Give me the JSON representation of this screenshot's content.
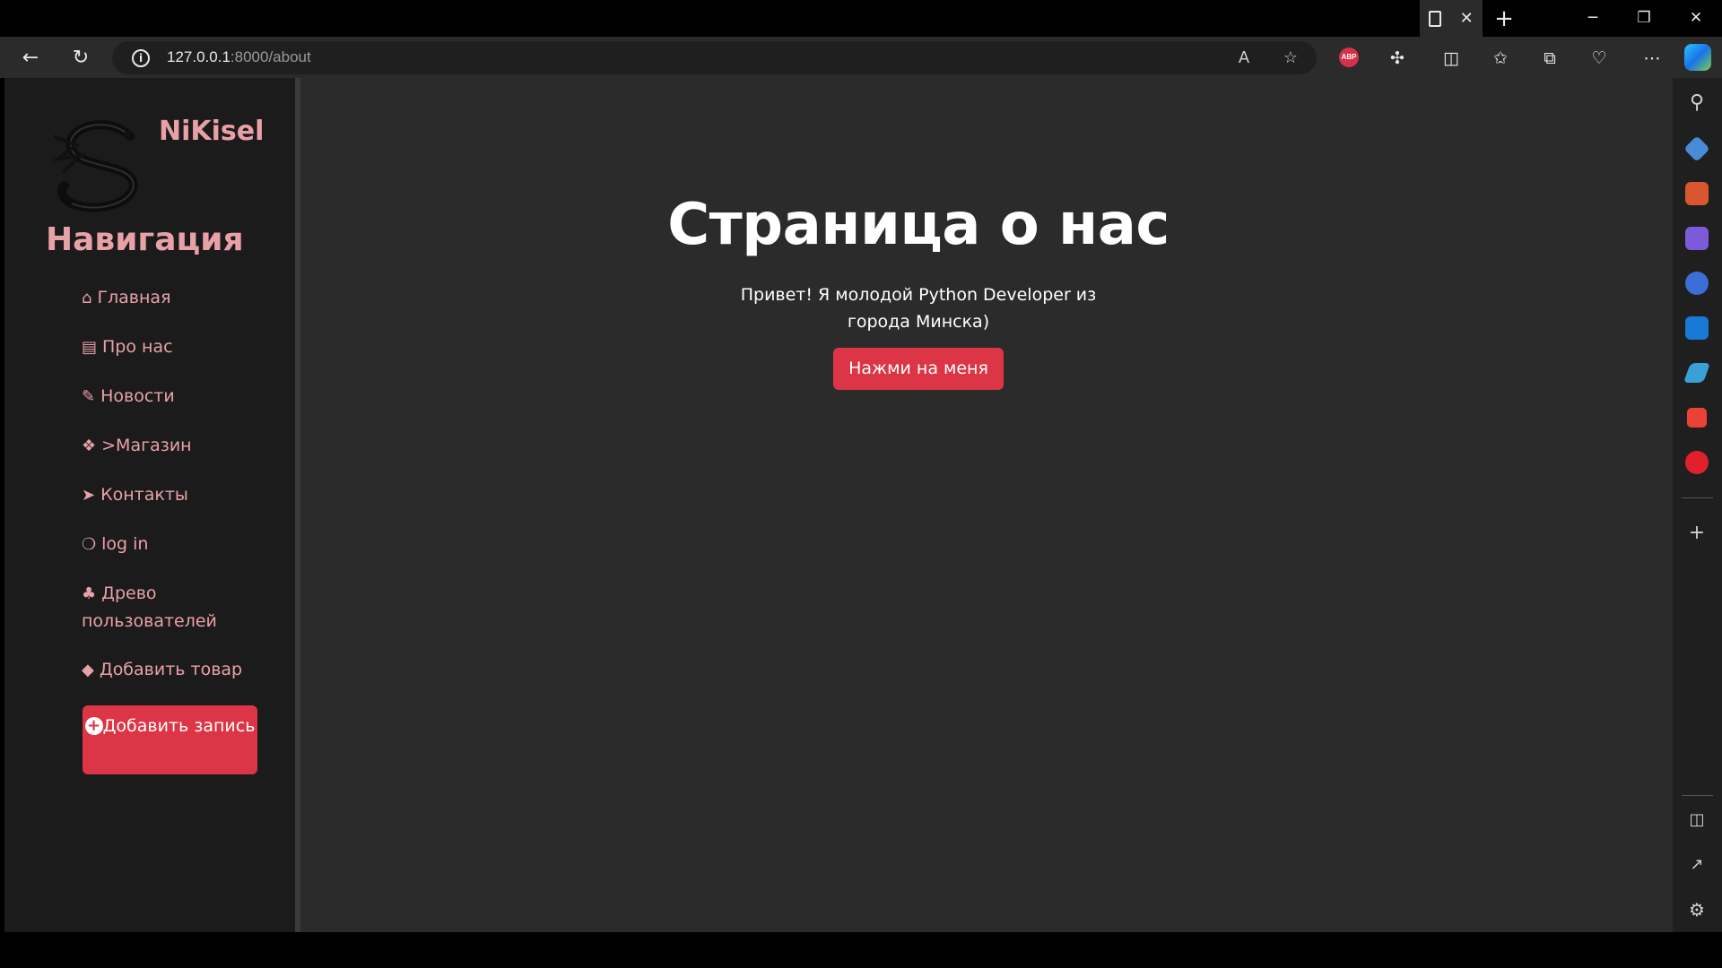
{
  "browser": {
    "tab_close": "✕",
    "new_tab": "+",
    "url_host": "127.0.0.1",
    "url_path": ":8000/about",
    "window_minimize": "─",
    "window_restore": "❐",
    "window_close": "✕",
    "abp_label": "ABP"
  },
  "sidebar": {
    "brand": "NiKisel",
    "nav_title": "Навигация",
    "items": [
      {
        "icon": "home-icon",
        "glyph": "⌂",
        "label": "Главная"
      },
      {
        "icon": "id-card-icon",
        "glyph": "▤",
        "label": "Про нас"
      },
      {
        "icon": "paperclip-icon",
        "glyph": "✎",
        "label": "Новости"
      },
      {
        "icon": "cubes-icon",
        "glyph": "❖",
        "label": ">Магазин"
      },
      {
        "icon": "paper-plane-icon",
        "glyph": "➤",
        "label": "Контакты"
      },
      {
        "icon": "shoe-prints-icon",
        "glyph": "❍",
        "label": "log in"
      },
      {
        "icon": "tree-icon",
        "glyph": "♣",
        "label": "Древо пользователей"
      },
      {
        "icon": "fire-icon",
        "glyph": "◆",
        "label": "Добавить товар"
      }
    ],
    "add_button": "Добавить запись"
  },
  "main": {
    "title": "Страница о нас",
    "text": "Привет! Я молодой Python Developer из города Минска)",
    "button": "Нажми на меня"
  },
  "colors": {
    "accent": "#dc3545",
    "link": "#e9a1a8",
    "sidebar_bg": "#1b1b1b",
    "content_bg": "#2b2b2b"
  }
}
